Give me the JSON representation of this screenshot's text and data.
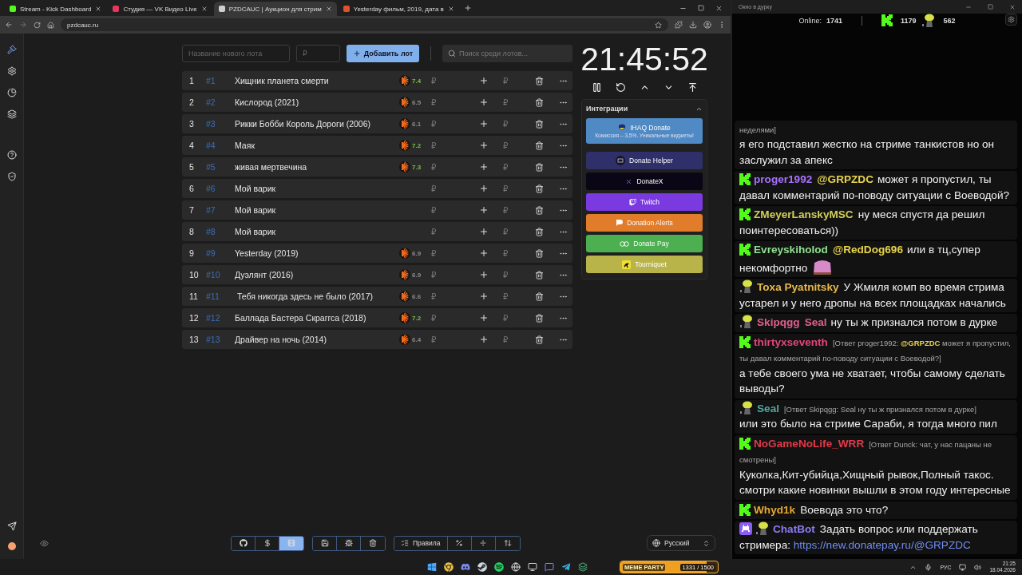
{
  "browser": {
    "tabs": [
      {
        "title": "Stream - Kick Dashboard",
        "selected": false,
        "color": "#53fc18"
      },
      {
        "title": "Студия — VK Видео Live",
        "selected": false,
        "color": "#e8355a"
      },
      {
        "title": "PZDCAUC | Аукцион для стрим",
        "selected": true,
        "color": "#cfcfcf"
      },
      {
        "title": "Yesterday фильм, 2019, дата в",
        "selected": false,
        "color": "#e0522a"
      }
    ],
    "url": "pzdcauc.ru"
  },
  "sidebar": {
    "items": [
      {
        "kind": "auction",
        "selected": true
      },
      {
        "kind": "settings",
        "selected": false
      },
      {
        "kind": "stats",
        "selected": false
      },
      {
        "kind": "layers",
        "selected": false
      },
      {
        "kind": "help",
        "selected": false
      },
      {
        "kind": "shield",
        "selected": false
      }
    ]
  },
  "new_lot": {
    "name_placeholder": "Название нового лота",
    "price_placeholder": "₽",
    "add_button": "Добавить лот"
  },
  "search": {
    "placeholder": "Поиск среди лотов..."
  },
  "lots": [
    {
      "index": "1",
      "id": "#1",
      "name": "Хищник планета смерти",
      "rating": {
        "value": "7.4",
        "color": "#7cc04a"
      },
      "amount_placeholder": "₽",
      "add_placeholder": "₽"
    },
    {
      "index": "2",
      "id": "#2",
      "name": "Кислород (2021)",
      "rating": {
        "value": "6.5",
        "color": "#8a8a8a"
      },
      "amount_placeholder": "₽",
      "add_placeholder": "₽"
    },
    {
      "index": "3",
      "id": "#3",
      "name": "Рикки Бобби Король Дороги (2006)",
      "rating": {
        "value": "6.1",
        "color": "#8a8a8a"
      },
      "amount_placeholder": "₽",
      "add_placeholder": "₽"
    },
    {
      "index": "4",
      "id": "#4",
      "name": "Маяк",
      "rating": {
        "value": "7.2",
        "color": "#7cc04a"
      },
      "amount_placeholder": "₽",
      "add_placeholder": "₽"
    },
    {
      "index": "5",
      "id": "#5",
      "name": "живая мертвечина",
      "rating": {
        "value": "7.3",
        "color": "#7cc04a"
      },
      "amount_placeholder": "₽",
      "add_placeholder": "₽"
    },
    {
      "index": "6",
      "id": "#6",
      "name": "Мой варик",
      "amount_placeholder": "₽",
      "add_placeholder": "₽"
    },
    {
      "index": "7",
      "id": "#7",
      "name": "Мой варик",
      "amount_placeholder": "₽",
      "add_placeholder": "₽"
    },
    {
      "index": "8",
      "id": "#8",
      "name": "Мой варик",
      "amount_placeholder": "₽",
      "add_placeholder": "₽"
    },
    {
      "index": "9",
      "id": "#9",
      "name": "Yesterday (2019)",
      "rating": {
        "value": "6.9",
        "color": "#8a8a8a"
      },
      "amount_placeholder": "₽",
      "add_placeholder": "₽"
    },
    {
      "index": "10",
      "id": "#10",
      "name": "Дуэлянт (2016)",
      "rating": {
        "value": "6.9",
        "color": "#8a8a8a"
      },
      "amount_placeholder": "₽",
      "add_placeholder": "₽"
    },
    {
      "index": "11",
      "id": "#11",
      "name": " Тебя никогда здесь не было (2017)",
      "rating": {
        "value": "6.6",
        "color": "#8a8a8a"
      },
      "amount_placeholder": "₽",
      "add_placeholder": "₽"
    },
    {
      "index": "12",
      "id": "#12",
      "name": "Баллада Бастера Скраггса (2018)",
      "rating": {
        "value": "7.2",
        "color": "#7cc04a"
      },
      "amount_placeholder": "₽",
      "add_placeholder": "₽"
    },
    {
      "index": "13",
      "id": "#13",
      "name": "Драйвер на ночь (2014)",
      "rating": {
        "value": "6.4",
        "color": "#8a8a8a"
      },
      "amount_placeholder": "₽",
      "add_placeholder": "₽"
    }
  ],
  "timer": "21:45:52",
  "integrations": {
    "title": "Интеграции",
    "expanded": true,
    "items": [
      {
        "kind": "ihaq",
        "label": "IHAQ Donate",
        "subtitle": "Комиссия – 3,5%. Уникальные виджеты!",
        "color": "#4f8ac4"
      },
      {
        "kind": "helper",
        "label": "Donate Helper",
        "color": "#2f2f6a"
      },
      {
        "kind": "donatex",
        "label": "DonateX",
        "color": "#0b0616"
      },
      {
        "kind": "twitch",
        "label": "Twitch",
        "color": "#7b3ae0"
      },
      {
        "kind": "alerts",
        "label": "Donation Alerts",
        "color": "#e07c2a"
      },
      {
        "kind": "donatepay",
        "label": "Donate Pay",
        "color": "#4caf50"
      },
      {
        "kind": "tourniquet",
        "label": "Tourniquet",
        "color": "#b8b44a"
      }
    ]
  },
  "toolbar": {
    "groups": [
      [
        {
          "kind": "github",
          "selected": false
        },
        {
          "kind": "dollar",
          "selected": false
        },
        {
          "kind": "film",
          "selected": true
        }
      ],
      [
        {
          "kind": "save",
          "selected": false
        },
        {
          "kind": "bug",
          "selected": false
        },
        {
          "kind": "trash",
          "selected": false
        }
      ],
      [
        {
          "kind": "rules",
          "label": "Правила",
          "selected": false
        },
        {
          "kind": "percent",
          "selected": false
        },
        {
          "kind": "divide",
          "selected": false
        },
        {
          "kind": "sort",
          "selected": false
        }
      ]
    ]
  },
  "language": "Русский",
  "chat": {
    "title": "Окно в дурку",
    "online_label": "Online:",
    "online_count": "1741",
    "kick_count": "1179",
    "other_count": "562",
    "messages": [
      {
        "reply": "неделями]",
        "text": "я его подставил жестко на стриме танкистов но он заслужил за апекс"
      },
      {
        "badges": [
          {
            "kind": "kick"
          }
        ],
        "user": "proger1992",
        "color": "#a970ff",
        "mention": {
          "text": "@GRPZDC",
          "color": "#e8d44a"
        },
        "text": "может я пропустил, ты давал комментарий по-поводу ситуации с Воеводой?"
      },
      {
        "badges": [
          {
            "kind": "kick"
          }
        ],
        "user": "ZMeyerLanskyMSC",
        "color": "#d2cf5a",
        "text": "ну меся спустя да решил поинтересоваться))"
      },
      {
        "badges": [
          {
            "kind": "kick"
          }
        ],
        "user": "Evreyskiholod",
        "color": "#8fe08f",
        "mention": {
          "text": "@RedDog696",
          "color": "#e8d44a"
        },
        "text": "или в тц,супер некомфортно",
        "emote": true
      },
      {
        "badges": [
          {
            "kind": "figure"
          }
        ],
        "user": "Toxa Pyatnitsky",
        "color": "#e8b84a",
        "text": "У Жмиля комп во время стрима устарел и у него дропы на всех площадках начались"
      },
      {
        "badges": [
          {
            "kind": "figure"
          }
        ],
        "user": "Skipqgg",
        "color": "#e0608e",
        "mention": {
          "text": "Seal",
          "color": "#e0608e"
        },
        "text": "ну ты ж признался потом в дурке"
      },
      {
        "badges": [
          {
            "kind": "kick"
          }
        ],
        "user": "thirtyxseventh",
        "color": "#e0457b",
        "reply": "[Ответ proger1992: **@GRPZDC** может я пропустил, ты давал комментарий по-поводу ситуации с Воеводой?]",
        "text": "а тебе своего ума не хватает, чтобы самому сделать выводы?"
      },
      {
        "badges": [
          {
            "kind": "figure"
          }
        ],
        "user": "Seal",
        "color": "#4fa8a0",
        "reply": "[Ответ Skipqgg: Seal ну ты ж признался потом в дурке]",
        "text": "или это было на стриме Сараби, я тогда много пил"
      },
      {
        "badges": [
          {
            "kind": "kick"
          }
        ],
        "user": "NoGameNoLife_WRR",
        "color": "#e03a4a",
        "reply": "[Ответ Dunck: чат, у нас пацаны не смотрены]",
        "text": "Куколка,Кит-убийца,Хищный рывок,Полный такос. смотри какие новинки вышли в этом году интересные"
      },
      {
        "badges": [
          {
            "kind": "kick"
          }
        ],
        "user": "Whyd1k",
        "color": "#e8a830",
        "text": "Воевода это что?"
      },
      {
        "badges": [
          {
            "kind": "bot"
          },
          {
            "kind": "figure"
          }
        ],
        "user": "ChatBot",
        "color": "#8b7bf0",
        "text": "Задать вопрос или поддержать стримера:",
        "link": "https://new.donatepay.ru/@GRPZDC"
      }
    ]
  },
  "taskbar": {
    "widget": {
      "title": "MEME PARTY",
      "progress": "1331 / 1500",
      "level": 0.887
    },
    "language": "РУС",
    "time": "21:25",
    "date": "18.04.2026"
  }
}
